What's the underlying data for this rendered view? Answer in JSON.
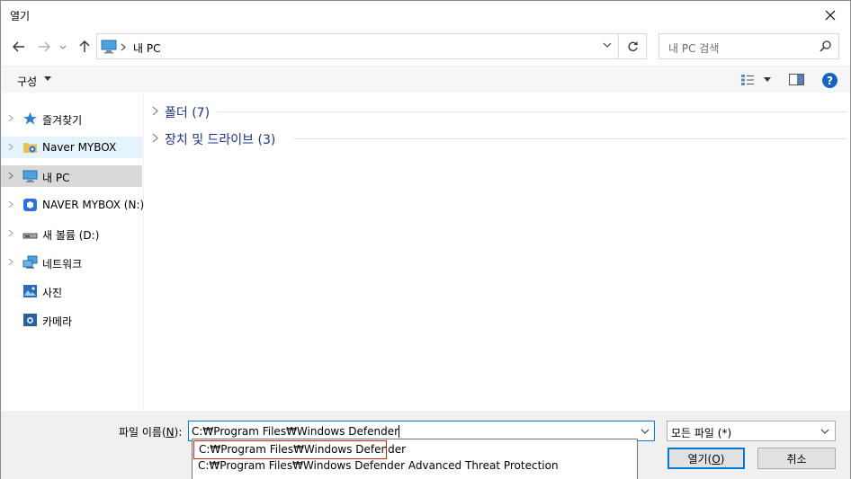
{
  "window": {
    "title": "열기"
  },
  "nav": {
    "address_path": "내 PC",
    "search_placeholder": "내 PC 검색"
  },
  "toolbar": {
    "organize_label": "구성"
  },
  "sidebar": {
    "items": [
      {
        "label": "즐겨찾기",
        "icon": "star-icon"
      },
      {
        "label": "Naver MYBOX",
        "icon": "mybox-folder-icon"
      },
      {
        "label": "내 PC",
        "icon": "computer-icon"
      },
      {
        "label": "NAVER MYBOX (N:)",
        "icon": "mybox-drive-icon"
      },
      {
        "label": "새 볼륨 (D:)",
        "icon": "drive-icon"
      },
      {
        "label": "네트워크",
        "icon": "network-icon"
      },
      {
        "label": "사진",
        "icon": "pictures-icon"
      },
      {
        "label": "카메라",
        "icon": "camera-icon"
      }
    ]
  },
  "main": {
    "groups": [
      {
        "label": "폴더 (7)"
      },
      {
        "label": "장치 및 드라이브 (3)"
      }
    ]
  },
  "bottom": {
    "filename_label_prefix": "파일 이름(",
    "filename_label_key": "N",
    "filename_label_suffix": "):",
    "filename_value": "C:₩Program Files₩Windows Defender",
    "filter_value": "모든 파일 (*)",
    "open_prefix": "열기(",
    "open_key": "O",
    "open_suffix": ")",
    "cancel_label": "취소"
  },
  "autocomplete": {
    "items": [
      "C:₩Program Files₩Windows Defender",
      "C:₩Program Files₩Windows Defender Advanced Threat Protection"
    ]
  },
  "colors": {
    "accent": "#0078d7",
    "group_text": "#1e3287",
    "selected_outline": "#c42b1c"
  }
}
